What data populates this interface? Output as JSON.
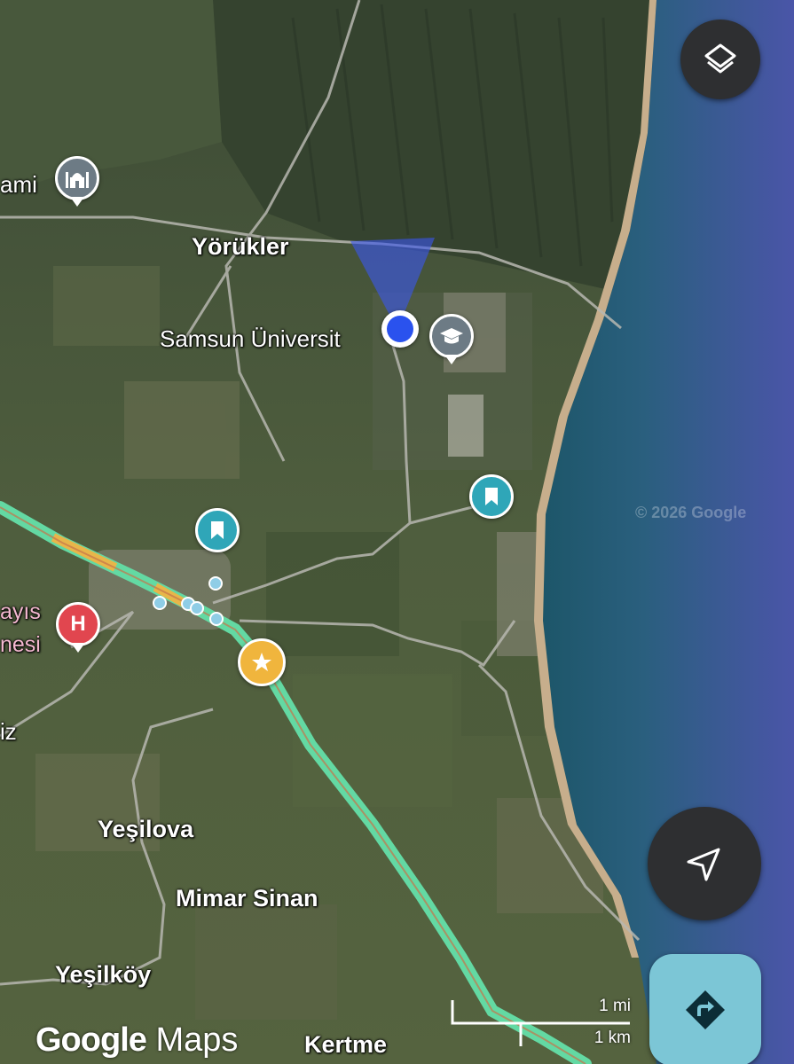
{
  "map": {
    "copyright": "© 2026 Google",
    "labels": {
      "cami": "ami",
      "yorukler": "Yörükler",
      "university": "Samsun Üniversit",
      "hospital_line1": "ayıs",
      "hospital_line2": "nesi",
      "edge_fragment": "iz",
      "yesilova": "Yeşilova",
      "mimar_sinan": "Mimar Sinan",
      "yesilkoy": "Yeşilköy",
      "kertme": "Kertme"
    },
    "icons": {
      "mosque": "mosque-icon",
      "graduation": "graduation-cap-icon",
      "bookmark": "bookmark-icon",
      "hospital": "hospital-icon",
      "star": "star-icon",
      "location": "current-location-dot"
    },
    "hospital_letter": "H",
    "colors": {
      "sea": "#1f5b72",
      "deep_sea": "#4757a8",
      "highway": "#63d9a3",
      "traffic": "#e7b64a",
      "hospital": "#e1464f",
      "bookmark": "#2fa6b8",
      "star": "#f0b53d",
      "location": "#2a52ee",
      "gray_poi": "#6d7b85"
    }
  },
  "controls": {
    "layers_icon": "layers-icon",
    "navigate_icon": "navigation-arrow-icon",
    "directions_icon": "directions-turn-icon"
  },
  "brand": {
    "logo_word1": "Google",
    "logo_word2": "Maps"
  },
  "scale": {
    "imperial": "1 mi",
    "metric": "1 km"
  }
}
